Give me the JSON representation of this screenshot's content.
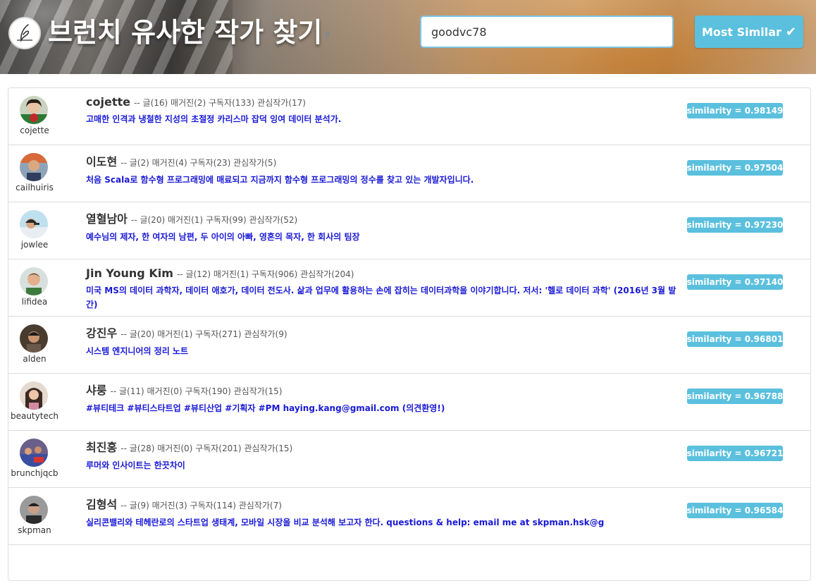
{
  "header": {
    "title": "브런치 유사한 작가 찾기",
    "help": "?",
    "search_value": "goodvc78",
    "button_label": "Most Similar",
    "button_icon": "check-icon",
    "accent_color": "#5bc0de"
  },
  "results": [
    {
      "username": "cojette",
      "name": "cojette",
      "stats": "-- 글(16) 매거진(2) 구독자(133) 관심작가(17)",
      "description": "고매한 인격과 냉철한 지성의 초절정 카리스마 잡덕 잉여 데이터 분석가.",
      "similarity": "similarity = 0.98149"
    },
    {
      "username": "cailhuiris",
      "name": "이도현",
      "stats": "-- 글(2) 매거진(4) 구독자(23) 관심작가(5)",
      "description": "처음 Scala로 함수형 프로그래밍에 매료되고 지금까지 함수형 프로그래밍의 정수를 찾고 있는 개발자입니다.",
      "similarity": "similarity = 0.97504"
    },
    {
      "username": "jowlee",
      "name": "열혈남아",
      "stats": "-- 글(20) 매거진(1) 구독자(99) 관심작가(52)",
      "description": "예수님의 제자, 한 여자의 남편, 두 아이의 아빠, 영혼의 목자, 한 회사의 팀장",
      "similarity": "similarity = 0.97230"
    },
    {
      "username": "lifidea",
      "name": "Jin Young Kim",
      "stats": "-- 글(12) 매거진(1) 구독자(906) 관심작가(204)",
      "description": "미국 MS의 데이터 과학자, 데이터 애호가, 데이터 전도사. 삶과 업무에 활용하는 손에 잡히는 데이터과학을 이야기합니다. 저서: '헬로 데이터 과학' (2016년 3월 발간)",
      "similarity": "similarity = 0.97140"
    },
    {
      "username": "alden",
      "name": "강진우",
      "stats": "-- 글(20) 매거진(1) 구독자(271) 관심작가(9)",
      "description": "시스템 엔지니어의 정리 노트",
      "similarity": "similarity = 0.96801"
    },
    {
      "username": "beautytech",
      "name": "샤룽",
      "stats": "-- 글(11) 매거진(0) 구독자(190) 관심작가(15)",
      "description": "#뷰티테크 #뷰티스타트업 #뷰티산업 #기획자 #PM haying.kang@gmail.com (의견환영!)",
      "similarity": "similarity = 0.96788"
    },
    {
      "username": "brunchjqcb",
      "name": "최진홍",
      "stats": "-- 글(28) 매거진(0) 구독자(201) 관심작가(15)",
      "description": "루머와 인사이트는 한끗차이",
      "similarity": "similarity = 0.96721"
    },
    {
      "username": "skpman",
      "name": "김형석",
      "stats": "-- 글(9) 매거진(3) 구독자(114) 관심작가(7)",
      "description": "실리콘밸리와 테헤란로의 스타트업 생태계, 모바일 시장을 비교 분석해 보고자 한다. questions & help: email me at skpman.hsk@g",
      "similarity": "similarity = 0.96584"
    }
  ]
}
